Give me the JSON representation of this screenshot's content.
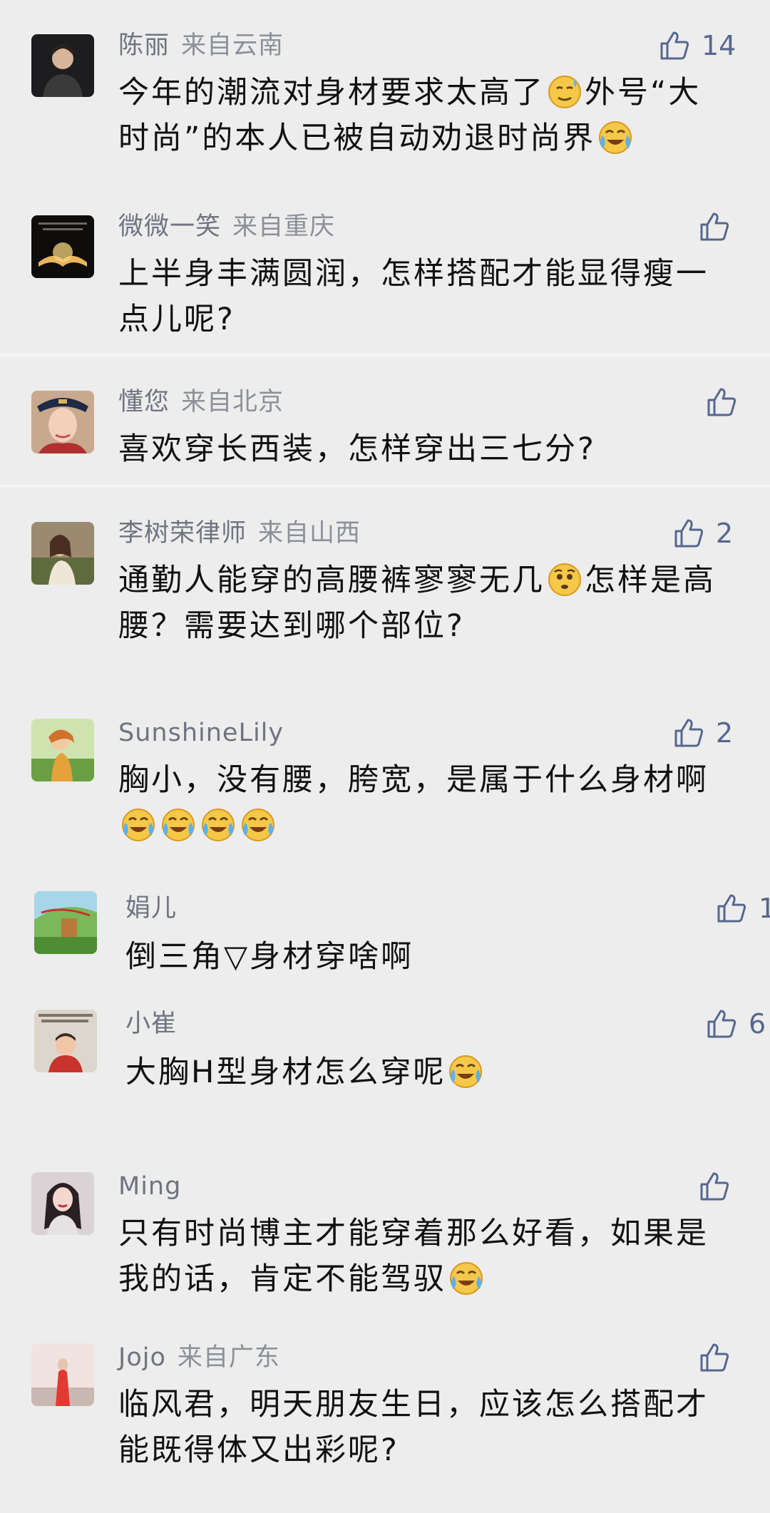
{
  "comments": [
    {
      "name": "陈丽",
      "location": "来自云南",
      "likes": "14",
      "line1": "今年的潮流对身材要求太高了",
      "line1b": "外号“大",
      "line2": "时尚”的本人已被自动劝退时尚界"
    },
    {
      "name": "微微一笑",
      "location": "来自重庆",
      "likes": "",
      "line1": "上半身丰满圆润，怎样搭配才能显得瘦一",
      "line2": "点儿呢?"
    },
    {
      "name": "懂您",
      "location": "来自北京",
      "likes": "",
      "line1": "喜欢穿长西装，怎样穿出三七分?"
    },
    {
      "name": "李树荣律师",
      "location": "来自山西",
      "likes": "2",
      "line1": "通勤人能穿的高腰裤寥寥无几",
      "line1b": "怎样是高",
      "line2": "腰？需要达到哪个部位?"
    },
    {
      "name": "SunshineLily",
      "location": "",
      "likes": "2",
      "line1": "胸小，没有腰，胯宽，是属于什么身材啊"
    },
    {
      "name": "娟儿",
      "location": "",
      "likes": "1",
      "line1": "倒三角▽身材穿啥啊"
    },
    {
      "name": "小崔",
      "location": "",
      "likes": "6",
      "line1": "大胸H型身材怎么穿呢"
    },
    {
      "name": "Ming",
      "location": "",
      "likes": "",
      "line1": "只有时尚博主才能穿着那么好看，如果是",
      "line2": "我的话，肯定不能驾驭"
    },
    {
      "name": "Jojo",
      "location": "来自广东",
      "likes": "",
      "line1": "临风君，明天朋友生日，应该怎么搭配才",
      "line2": "能既得体又出彩呢?"
    }
  ],
  "colors": {
    "like": "#56678e",
    "name": "#6f7480",
    "text": "#111111",
    "background": "#ededed"
  },
  "icons": {
    "like": "thumbs-up-icon",
    "emoji_cry": "crying-laughing-emoji",
    "emoji_sweat": "sweat-smile-emoji",
    "emoji_worried": "worried-emoji"
  }
}
